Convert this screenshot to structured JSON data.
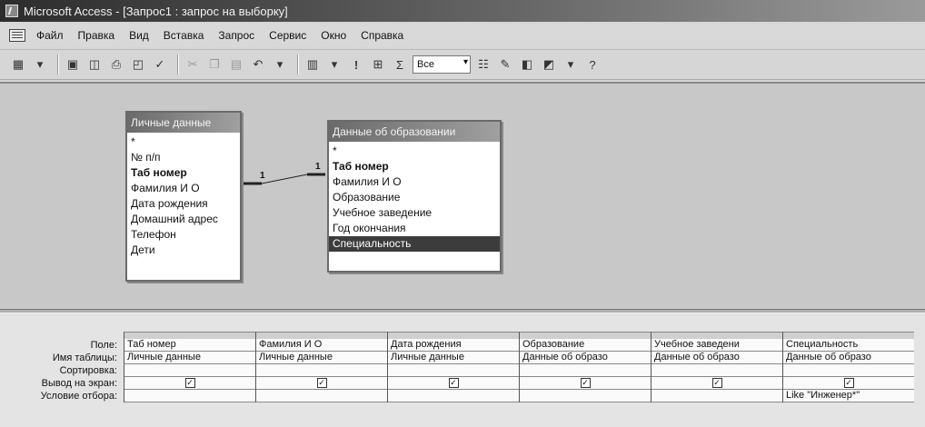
{
  "window": {
    "title": "Microsoft Access - [Запрос1 : запрос на выборку]"
  },
  "menu": [
    {
      "label": "Файл"
    },
    {
      "label": "Правка"
    },
    {
      "label": "Вид"
    },
    {
      "label": "Вставка"
    },
    {
      "label": "Запрос"
    },
    {
      "label": "Сервис"
    },
    {
      "label": "Окно"
    },
    {
      "label": "Справка"
    }
  ],
  "toolbar": {
    "top_values": "Все",
    "sigma": "Σ",
    "run": "!",
    "undo": "↶",
    "help": "?"
  },
  "tables": [
    {
      "name": "Личные данные",
      "fields": [
        "*",
        "№ п/п",
        "Таб номер",
        "Фамилия И О",
        "Дата рождения",
        "Домашний адрес",
        "Телефон",
        "Дети"
      ]
    },
    {
      "name": "Данные об образовании",
      "fields": [
        "*",
        "Таб номер",
        "Фамилия И О",
        "Образование",
        "Учебное заведение",
        "Год окончания",
        "Специальность"
      ]
    }
  ],
  "relationship": {
    "left": "1",
    "right": "1"
  },
  "grid": {
    "row_labels": [
      "Поле:",
      "Имя таблицы:",
      "Сортировка:",
      "Вывод на экран:",
      "Условие отбора:"
    ],
    "columns": [
      {
        "field": "Таб номер",
        "table": "Личные данные",
        "sort": "",
        "show": "✓",
        "criteria": ""
      },
      {
        "field": "Фамилия И О",
        "table": "Личные данные",
        "sort": "",
        "show": "✓",
        "criteria": ""
      },
      {
        "field": "Дата рождения",
        "table": "Личные данные",
        "sort": "",
        "show": "✓",
        "criteria": ""
      },
      {
        "field": "Образование",
        "table": "Данные об образо",
        "sort": "",
        "show": "✓",
        "criteria": ""
      },
      {
        "field": "Учебное заведени",
        "table": "Данные об образо",
        "sort": "",
        "show": "✓",
        "criteria": ""
      },
      {
        "field": "Специальность",
        "table": "Данные об образо",
        "sort": "",
        "show": "✓",
        "criteria": "Like \"Инженер*\""
      }
    ]
  }
}
